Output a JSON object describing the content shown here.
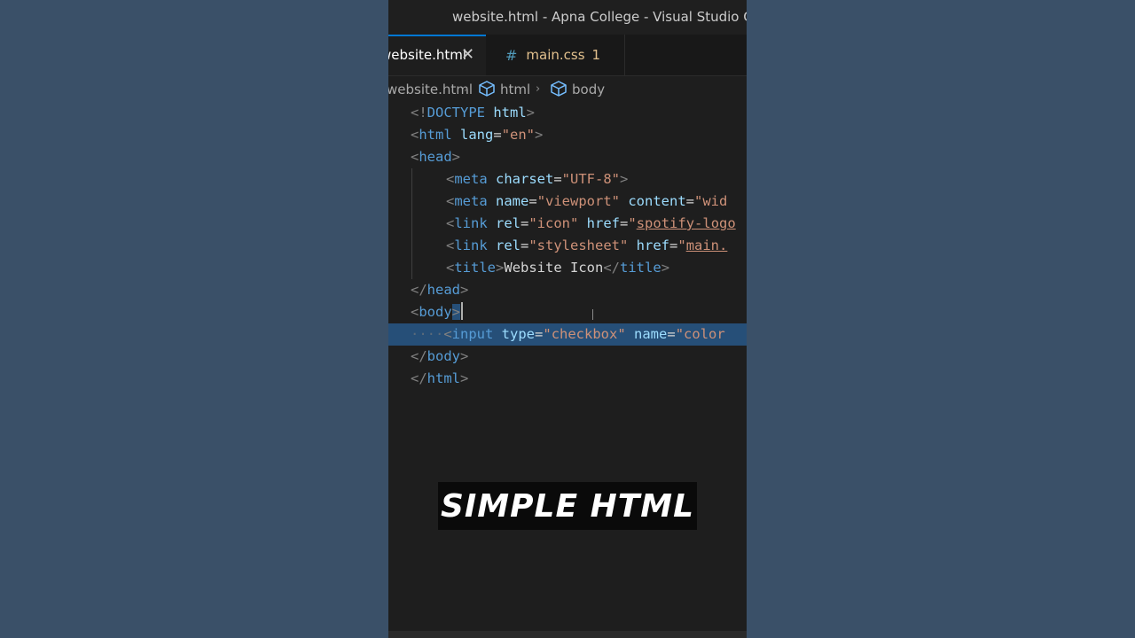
{
  "window": {
    "title": "website.html - Apna College - Visual Studio Code"
  },
  "tabs": [
    {
      "label": "website.html",
      "close": "✕"
    },
    {
      "icon": "#",
      "label": "main.css",
      "count": "1"
    }
  ],
  "breadcrumb": [
    {
      "label": "website.html"
    },
    {
      "label": "html",
      "icon": "cube-icon"
    },
    {
      "label": "body",
      "icon": "cube-icon"
    }
  ],
  "breadcrumb_sep": "›",
  "code": {
    "l1": {
      "t1": "<!",
      "t2": "DOCTYPE",
      "t3": " html",
      "t4": ">"
    },
    "l2": {
      "t1": "<",
      "t2": "html",
      "t3": " lang",
      "t4": "=",
      "t5": "\"en\"",
      "t6": ">"
    },
    "l3": {
      "t1": "<",
      "t2": "head",
      "t3": ">"
    },
    "l4": {
      "t1": "<",
      "t2": "meta",
      "t3": " charset",
      "t4": "=",
      "t5": "\"UTF-8\"",
      "t6": ">"
    },
    "l5": {
      "t1": "<",
      "t2": "meta",
      "t3": " name",
      "t4": "=",
      "t5": "\"viewport\"",
      "t6": " content",
      "t7": "=",
      "t8": "\"wid"
    },
    "l6": {
      "t1": "<",
      "t2": "link",
      "t3": " rel",
      "t4": "=",
      "t5": "\"icon\"",
      "t6": " href",
      "t7": "=",
      "t8": "\"",
      "t9": "spotify-logo"
    },
    "l7": {
      "t1": "<",
      "t2": "link",
      "t3": " rel",
      "t4": "=",
      "t5": "\"stylesheet\"",
      "t6": " href",
      "t7": "=",
      "t8": "\"",
      "t9": "main."
    },
    "l8": {
      "t1": "<",
      "t2": "title",
      "t3": ">",
      "t4": "Website Icon",
      "t5": "</",
      "t6": "title",
      "t7": ">"
    },
    "l9": {
      "t1": "</",
      "t2": "head",
      "t3": ">"
    },
    "l10": {
      "t1": "<",
      "t2": "body",
      "t3": ">"
    },
    "l11": {
      "ws": "····",
      "t1": "<",
      "t2": "input",
      "t3": " type",
      "t4": "=",
      "t5": "\"checkbox\"",
      "t6": " name",
      "t7": "=",
      "t8": "\"color"
    },
    "l12": {
      "t1": "</",
      "t2": "body",
      "t3": ">"
    },
    "l13": {
      "t1": "</",
      "t2": "html",
      "t3": ">"
    }
  },
  "caption": "SIMPLE HTML",
  "colors": {
    "background": "#3a5068",
    "editor": "#1e1e1e",
    "accent": "#0078d4",
    "selection": "#264f78"
  }
}
